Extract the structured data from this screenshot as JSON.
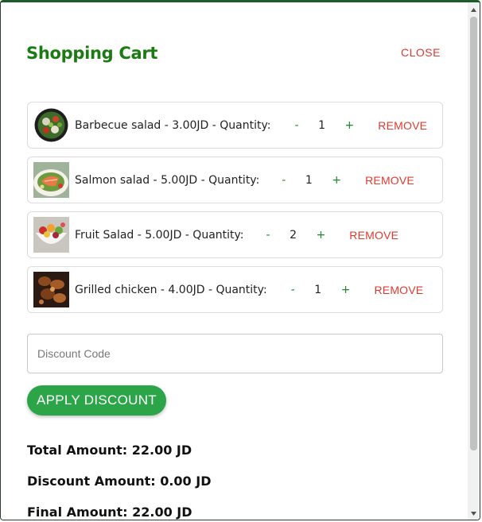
{
  "modal": {
    "title": "Shopping Cart",
    "close_label": "CLOSE"
  },
  "cart": {
    "items": [
      {
        "name": "Barbecue salad",
        "desc": "Barbecue salad - 3.00JD - Quantity:",
        "quantity": "1",
        "minus": "-",
        "plus": "+",
        "remove_label": "REMOVE",
        "image": "barbecue-salad-image"
      },
      {
        "name": "Salmon salad",
        "desc": "Salmon salad - 5.00JD - Quantity:",
        "quantity": "1",
        "minus": "-",
        "plus": "+",
        "remove_label": "REMOVE",
        "image": "salmon-salad-image"
      },
      {
        "name": "Fruit Salad",
        "desc": "Fruit Salad - 5.00JD - Quantity:",
        "quantity": "2",
        "minus": "-",
        "plus": "+",
        "remove_label": "REMOVE",
        "image": "fruit-salad-image"
      },
      {
        "name": "Grilled chicken",
        "desc": "Grilled chicken - 4.00JD - Quantity:",
        "quantity": "1",
        "minus": "-",
        "plus": "+",
        "remove_label": "REMOVE",
        "image": "grilled-chicken-image"
      }
    ]
  },
  "discount": {
    "placeholder": "Discount Code",
    "value": "",
    "apply_label": "APPLY DISCOUNT"
  },
  "totals": {
    "total": "Total Amount: 22.00 JD",
    "discount": "Discount Amount: 0.00 JD",
    "final": "Final Amount: 22.00 JD"
  },
  "colors": {
    "title": "#1b7a12",
    "close": "#e0392f",
    "remove": "#e0392f",
    "qty_buttons": "#1b8a26",
    "apply_button": "#2ca548"
  }
}
